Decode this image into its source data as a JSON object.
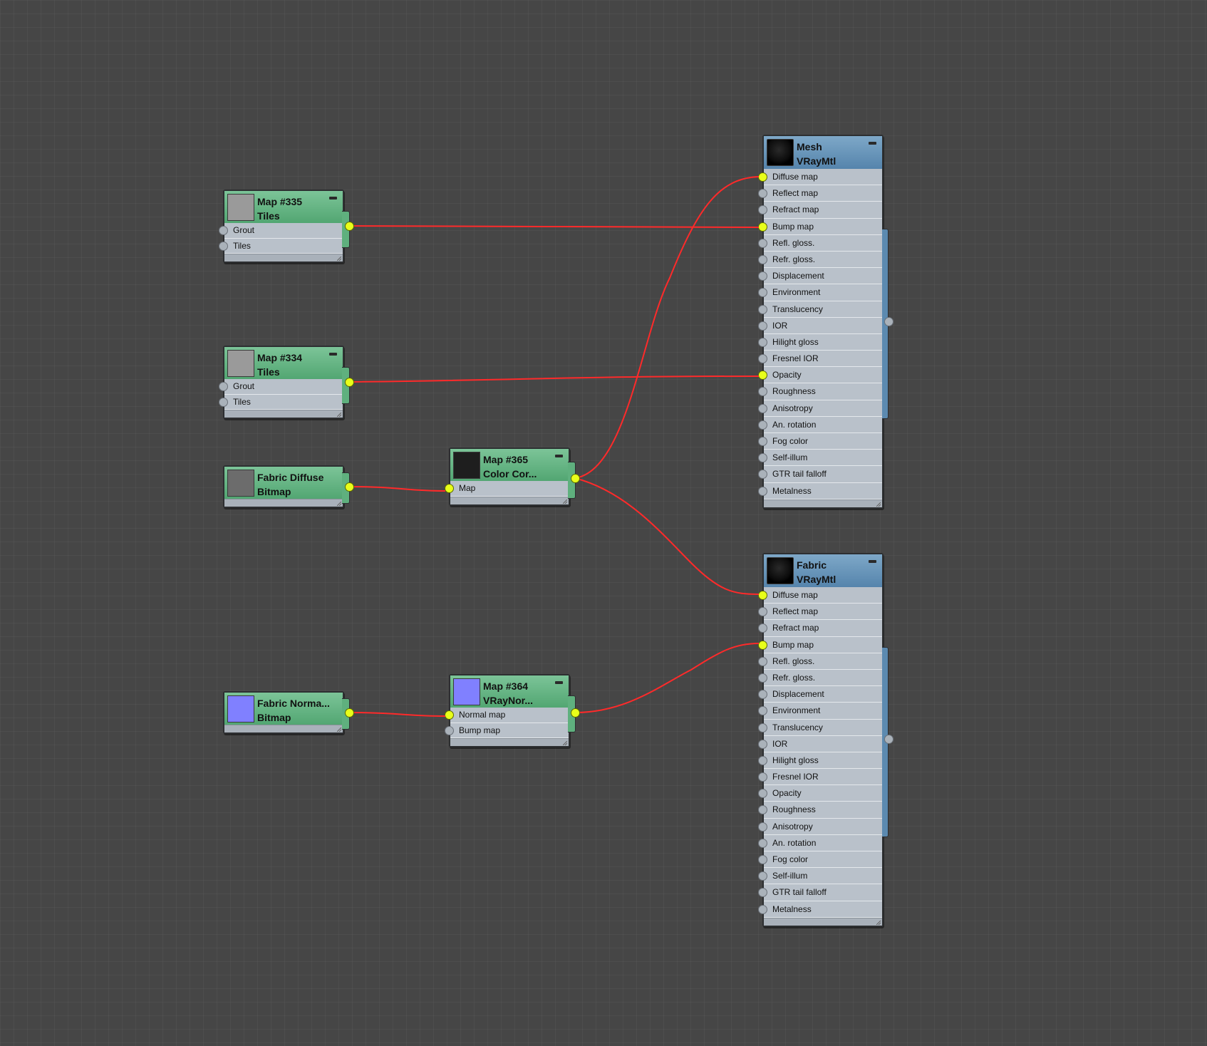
{
  "colors": {
    "wire": "#ff2a2a",
    "socket_connected": "#e8ff1a",
    "map_header": "#5dac7a",
    "material_header": "#5d8cb4",
    "canvas": "#464646"
  },
  "nodes": {
    "map335": {
      "name": "Map #335",
      "type": "Tiles",
      "thumb": "#9a9a9a",
      "slots": [
        "Grout",
        "Tiles"
      ]
    },
    "map334": {
      "name": "Map #334",
      "type": "Tiles",
      "thumb": "#9a9a9a",
      "slots": [
        "Grout",
        "Tiles"
      ]
    },
    "fabric_diffuse": {
      "name": "Fabric Diffuse",
      "type": "Bitmap",
      "thumb": "#6c6c6c"
    },
    "map365": {
      "name": "Map #365",
      "type": "Color Cor...",
      "thumb": "#1e1e1e",
      "slots": [
        "Map"
      ]
    },
    "fabric_normal": {
      "name": "Fabric Norma...",
      "type": "Bitmap",
      "thumb": "#8080ff"
    },
    "map364": {
      "name": "Map #364",
      "type": "VRayNor...",
      "thumb": "#8080ff",
      "slots": [
        "Normal map",
        "Bump map"
      ]
    },
    "mesh": {
      "name": "Mesh",
      "type": "VRayMtl",
      "slots": [
        "Diffuse map",
        "Reflect map",
        "Refract map",
        "Bump map",
        "Refl. gloss.",
        "Refr. gloss.",
        "Displacement",
        "Environment",
        "Translucency",
        "IOR",
        "Hilight gloss",
        "Fresnel IOR",
        "Opacity",
        "Roughness",
        "Anisotropy",
        "An. rotation",
        "Fog color",
        "Self-illum",
        "GTR tail falloff",
        "Metalness"
      ]
    },
    "fabric": {
      "name": "Fabric",
      "type": "VRayMtl",
      "slots": [
        "Diffuse map",
        "Reflect map",
        "Refract map",
        "Bump map",
        "Refl. gloss.",
        "Refr. gloss.",
        "Displacement",
        "Environment",
        "Translucency",
        "IOR",
        "Hilight gloss",
        "Fresnel IOR",
        "Opacity",
        "Roughness",
        "Anisotropy",
        "An. rotation",
        "Fog color",
        "Self-illum",
        "GTR tail falloff",
        "Metalness"
      ]
    }
  }
}
